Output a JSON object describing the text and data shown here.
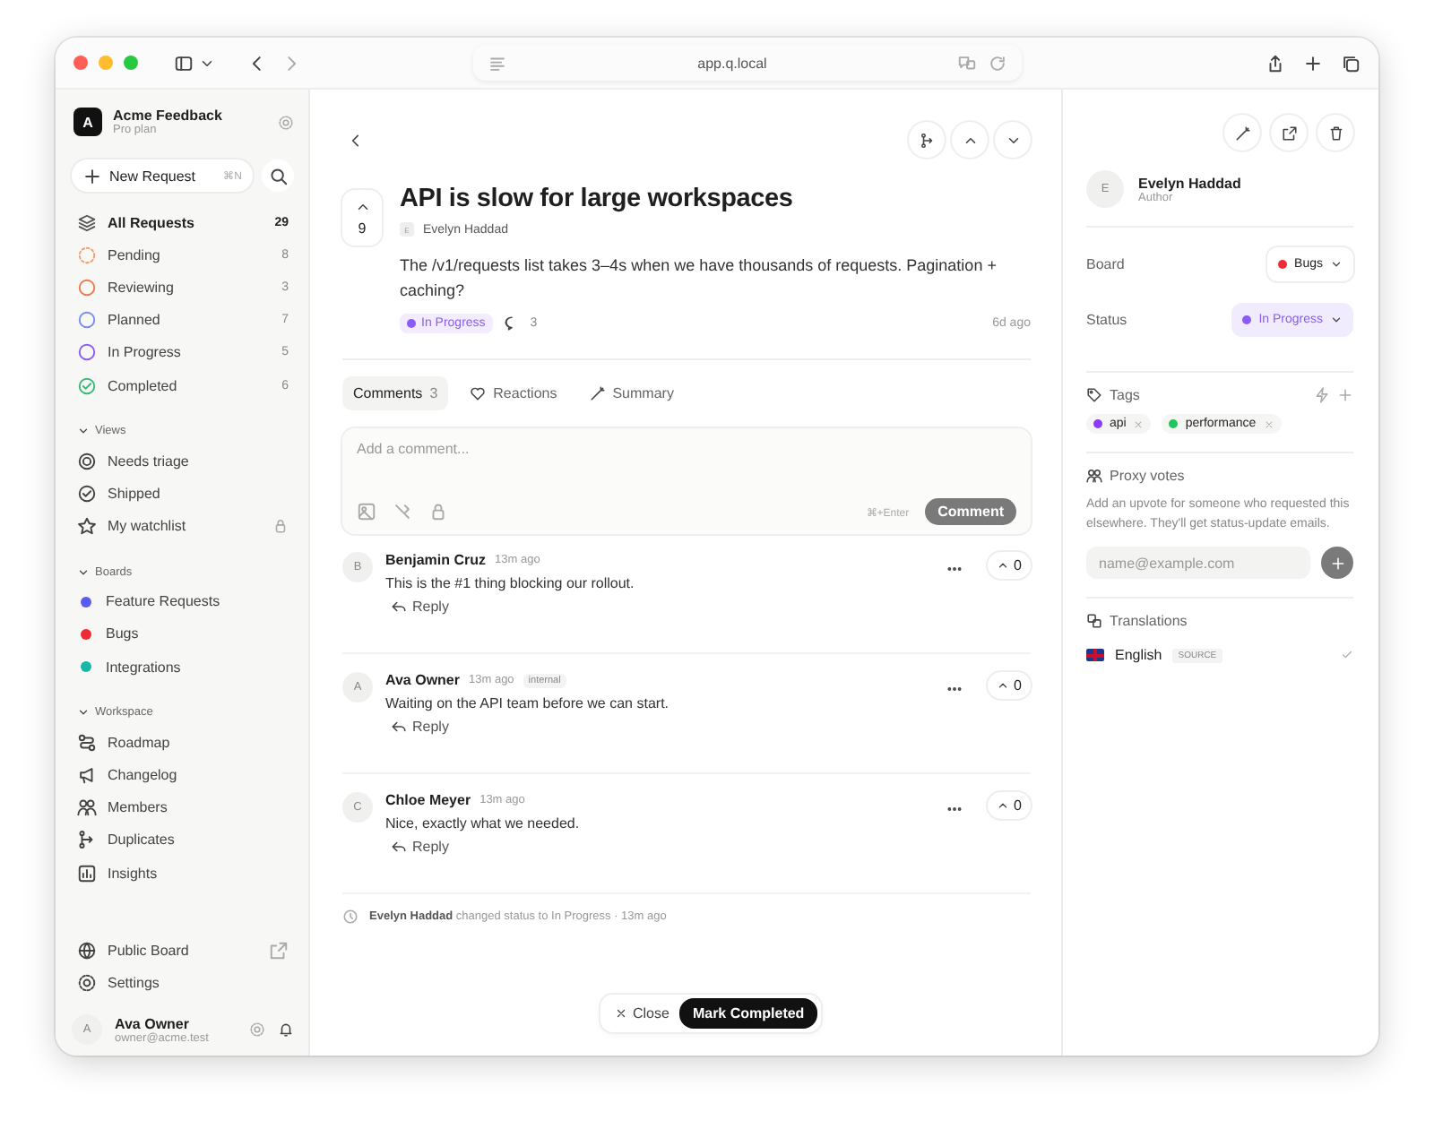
{
  "browser": {
    "url": "app.q.local"
  },
  "sidebar": {
    "workspace": {
      "initial": "A",
      "name": "Acme Feedback",
      "plan": "Pro plan"
    },
    "new_request": {
      "label": "New Request",
      "shortcut": "⌘N"
    },
    "statuses": [
      {
        "label": "All Requests",
        "count": "29",
        "color": "#555555",
        "selected": true
      },
      {
        "label": "Pending",
        "count": "8",
        "color": "#f0a070",
        "selected": false
      },
      {
        "label": "Reviewing",
        "count": "3",
        "color": "#f07850",
        "selected": false
      },
      {
        "label": "Planned",
        "count": "7",
        "color": "#7b8cf0",
        "selected": false
      },
      {
        "label": "In Progress",
        "count": "5",
        "color": "#8b5cf6",
        "selected": false
      },
      {
        "label": "Completed",
        "count": "6",
        "color": "#3cb878",
        "selected": false
      }
    ],
    "sections": [
      {
        "title": "Views",
        "expanded": true,
        "items": [
          {
            "label": "Needs triage"
          },
          {
            "label": "Shipped"
          },
          {
            "label": "My watchlist",
            "locked": true
          }
        ]
      },
      {
        "title": "Boards",
        "expanded": true,
        "items": [
          {
            "label": "Feature Requests",
            "color": "#5b5bf0"
          },
          {
            "label": "Bugs",
            "color": "#ef2b35"
          },
          {
            "label": "Integrations",
            "color": "#14b8a6"
          }
        ]
      },
      {
        "title": "Workspace",
        "expanded": true,
        "items": [
          {
            "label": "Roadmap"
          },
          {
            "label": "Changelog"
          },
          {
            "label": "Members"
          },
          {
            "label": "Duplicates"
          },
          {
            "label": "Insights"
          }
        ]
      }
    ],
    "footer_items": [
      {
        "label": "Public Board"
      },
      {
        "label": "Settings"
      }
    ],
    "user": {
      "initial": "A",
      "name": "Ava Owner",
      "email": "owner@acme.test"
    }
  },
  "request": {
    "votes": "9",
    "title": "API is slow for large workspaces",
    "author_initial": "E",
    "author": "Evelyn Haddad",
    "body": "The /v1/requests list takes 3–4s when we have thousands of requests. Pagination + caching?",
    "status": {
      "label": "In Progress",
      "color": "#8b5cf6"
    },
    "comment_count": "3",
    "age": "6d ago"
  },
  "tabs": [
    {
      "label": "Comments",
      "count": "3",
      "selected": true
    },
    {
      "label": "Reactions",
      "selected": false
    },
    {
      "label": "Summary",
      "selected": false
    }
  ],
  "composer": {
    "placeholder": "Add a comment...",
    "shortcut": "⌘+Enter",
    "button": "Comment"
  },
  "comments": [
    {
      "initial": "B",
      "author": "Benjamin Cruz",
      "time": "13m ago",
      "text": "This is the #1 thing blocking our rollout.",
      "reply": "Reply",
      "votes": "0"
    },
    {
      "initial": "A",
      "author": "Ava Owner",
      "time": "13m ago",
      "badge": "internal",
      "text": "Waiting on the API team before we can start.",
      "reply": "Reply",
      "votes": "0"
    },
    {
      "initial": "C",
      "author": "Chloe Meyer",
      "time": "13m ago",
      "text": "Nice, exactly what we needed.",
      "reply": "Reply",
      "votes": "0"
    }
  ],
  "activity": "**Evelyn Haddad** changed status to In Progress · 13m ago",
  "actions": {
    "close": "Close",
    "complete": "Mark Completed"
  },
  "panel": {
    "author": {
      "initial": "E",
      "name": "Evelyn Haddad",
      "role": "Author"
    },
    "fields": [
      {
        "kind": "board",
        "label": "Board",
        "value": "Bugs",
        "color": "#ef2b35"
      },
      {
        "kind": "status",
        "label": "Status",
        "value": "In Progress",
        "color": "#8b5cf6"
      }
    ],
    "tags": {
      "title": "Tags",
      "items": [
        {
          "label": "api",
          "color": "#8b3cf6"
        },
        {
          "label": "performance",
          "color": "#22c55e"
        }
      ]
    },
    "proxy": {
      "title": "Proxy votes",
      "description": "Add an upvote for someone who requested this elsewhere. They'll get status-update emails.",
      "placeholder": "name@example.com"
    },
    "translations": {
      "title": "Translations",
      "items": [
        {
          "language": "English",
          "badge": "SOURCE",
          "done": true
        }
      ]
    }
  }
}
